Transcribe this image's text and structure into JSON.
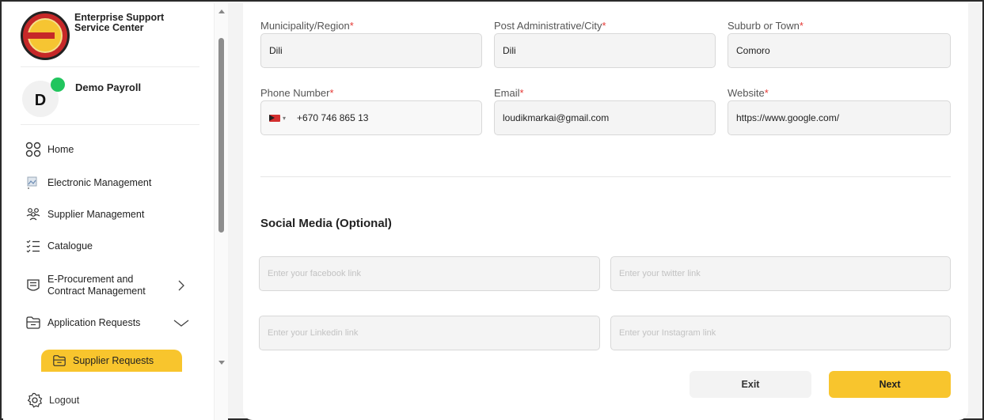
{
  "brand": {
    "name": "Enterprise Support Service Center"
  },
  "user": {
    "initial": "D",
    "name": "Demo Payroll",
    "status_color": "#22c55e"
  },
  "sidebar": {
    "items": [
      {
        "label": "Home",
        "icon": "grid-icon"
      },
      {
        "label": "Electronic Management",
        "icon": "broken-image-icon"
      },
      {
        "label": "Supplier Management",
        "icon": "users-group-icon"
      },
      {
        "label": "Catalogue",
        "icon": "checklist-icon"
      },
      {
        "label": "E-Procurement and Contract Management",
        "icon": "document-list-icon",
        "chevron": "chevron-right-icon"
      },
      {
        "label": "Application Requests",
        "icon": "folder-icon",
        "chevron": "chevron-down-icon"
      }
    ],
    "active_item": {
      "label": "Supplier Requests",
      "icon": "folder-icon"
    },
    "logout": {
      "label": "Logout",
      "icon": "gear-icon"
    }
  },
  "form": {
    "municipality": {
      "label": "Municipality/Region",
      "required": "*",
      "value": "Dili"
    },
    "post_admin": {
      "label": "Post Administrative/City",
      "required": "*",
      "value": "Dili"
    },
    "suburb": {
      "label": "Suburb or Town",
      "required": "*",
      "value": "Comoro"
    },
    "phone": {
      "label": "Phone Number",
      "required": "*",
      "value": "+670 746 865 13",
      "caret": "▾"
    },
    "email": {
      "label": "Email",
      "required": "*",
      "value": "loudikmarkai@gmail.com"
    },
    "website": {
      "label": "Website",
      "required": "*",
      "value": "https://www.google.com/"
    }
  },
  "social": {
    "title": "Social Media (Optional)",
    "facebook_placeholder": "Enter your facebook link",
    "twitter_placeholder": "Enter your twitter link",
    "linkedin_placeholder": "Enter your Linkedin link",
    "instagram_placeholder": "Enter your Instagram link"
  },
  "actions": {
    "exit_label": "Exit",
    "next_label": "Next"
  },
  "colors": {
    "accent": "#f8c52d",
    "required": "#e53935"
  }
}
